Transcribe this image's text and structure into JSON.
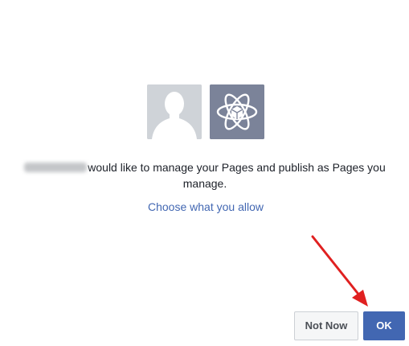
{
  "dialog": {
    "user_avatar_icon": "user-silhouette-icon",
    "app_avatar_icon": "atom-icon",
    "message_rest": "would like to manage your Pages and publish as Pages you manage.",
    "choose_link": "Choose what you allow",
    "not_now_label": "Not Now",
    "ok_label": "OK"
  },
  "colors": {
    "accent": "#4267b2",
    "annotation_arrow": "#e02020"
  }
}
